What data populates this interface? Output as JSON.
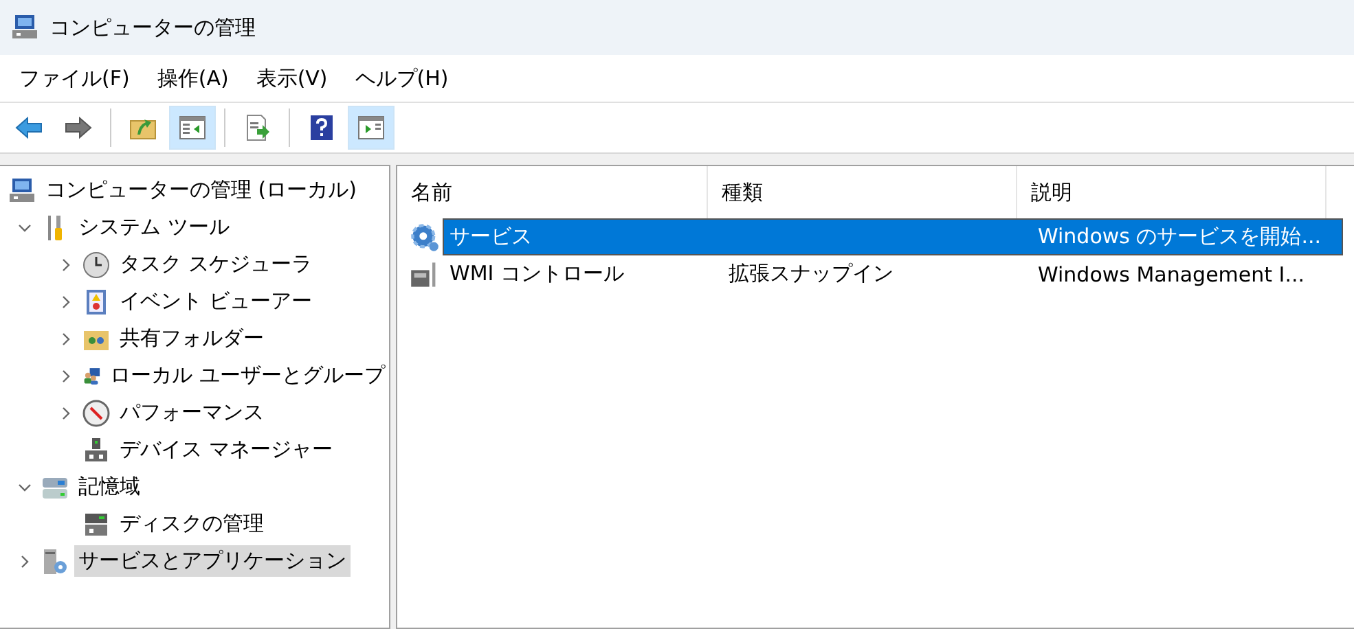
{
  "window": {
    "title": "コンピューターの管理"
  },
  "menu": [
    {
      "label": "ファイル(F)"
    },
    {
      "label": "操作(A)"
    },
    {
      "label": "表示(V)"
    },
    {
      "label": "ヘルプ(H)"
    }
  ],
  "toolbar": [
    {
      "kind": "back",
      "on": false
    },
    {
      "kind": "forward",
      "on": false
    },
    {
      "kind": "separator"
    },
    {
      "kind": "up",
      "on": false
    },
    {
      "kind": "tree",
      "on": true
    },
    {
      "kind": "separator"
    },
    {
      "kind": "export",
      "on": false
    },
    {
      "kind": "separator"
    },
    {
      "kind": "help",
      "on": false
    },
    {
      "kind": "action",
      "on": true
    }
  ],
  "tree": [
    {
      "label": "コンピューターの管理 (ローカル)",
      "kind": "computer",
      "selected": false,
      "children": [
        {
          "label": "システム ツール",
          "kind": "tools",
          "expanded": true,
          "selected": false,
          "children": [
            {
              "label": "タスク スケジューラ",
              "kind": "clock",
              "expanded": false,
              "selected": false
            },
            {
              "label": "イベント ビューアー",
              "kind": "log",
              "expanded": false,
              "selected": false
            },
            {
              "label": "共有フォルダー",
              "kind": "folder",
              "expanded": false,
              "selected": false
            },
            {
              "label": "ローカル ユーザーとグループ",
              "kind": "users",
              "expanded": false,
              "selected": false
            },
            {
              "label": "パフォーマンス",
              "kind": "gauge",
              "expanded": false,
              "selected": false
            },
            {
              "label": "デバイス マネージャー",
              "kind": "device",
              "selected": false
            }
          ]
        },
        {
          "label": "記憶域",
          "kind": "storage",
          "expanded": true,
          "selected": false,
          "children": [
            {
              "label": "ディスクの管理",
              "kind": "disk",
              "selected": false
            }
          ]
        },
        {
          "label": "サービスとアプリケーション",
          "kind": "services",
          "expanded": false,
          "selected": true
        }
      ]
    }
  ],
  "table": {
    "columns": [
      {
        "label": "名前"
      },
      {
        "label": "種類"
      },
      {
        "label": "説明"
      }
    ],
    "rows": [
      {
        "kind": "gear",
        "selected": true,
        "cells": [
          "サービス",
          "",
          "Windows のサービスを開始..."
        ]
      },
      {
        "kind": "wmi",
        "selected": false,
        "cells": [
          "WMI コントロール",
          "拡張スナップイン",
          "Windows Management I..."
        ]
      }
    ]
  }
}
